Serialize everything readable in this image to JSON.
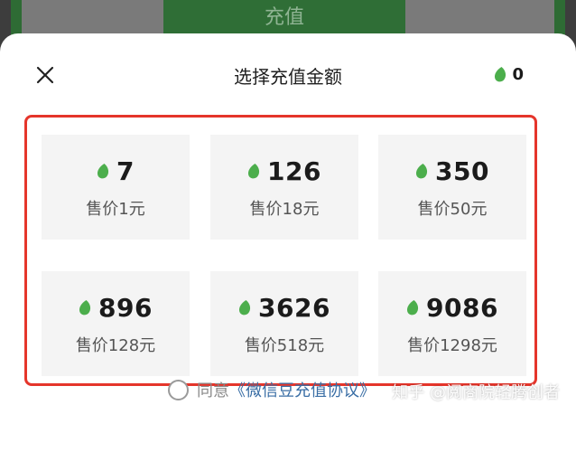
{
  "background": {
    "recharge_label": "充值"
  },
  "header": {
    "title": "选择充值金额",
    "balance": "0",
    "close_icon": "close-icon",
    "coin_icon": "green-leaf-icon"
  },
  "options": [
    {
      "amount": "7",
      "price": "售价1元"
    },
    {
      "amount": "126",
      "price": "售价18元"
    },
    {
      "amount": "350",
      "price": "售价50元"
    },
    {
      "amount": "896",
      "price": "售价128元"
    },
    {
      "amount": "3626",
      "price": "售价518元"
    },
    {
      "amount": "9086",
      "price": "售价1298元"
    }
  ],
  "agreement": {
    "prefix": "同意",
    "link": "《微信豆充值协议》"
  },
  "watermark": "知乎 @阅商院轻腾创者",
  "colors": {
    "accent_green": "#4cae4c",
    "highlight_red": "#e5352b",
    "link_blue": "#3a6ea5"
  }
}
